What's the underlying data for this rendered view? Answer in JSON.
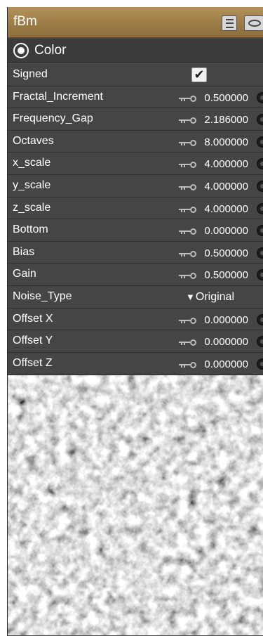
{
  "node": {
    "title": "fBm",
    "section_label": "Color"
  },
  "rows": [
    {
      "label": "Signed",
      "kind": "checkbox",
      "checked": true,
      "check_glyph": "✔"
    },
    {
      "label": "Fractal_Increment",
      "kind": "number",
      "value": "0.500000"
    },
    {
      "label": "Frequency_Gap",
      "kind": "number",
      "value": "2.186000"
    },
    {
      "label": "Octaves",
      "kind": "number",
      "value": "8.000000"
    },
    {
      "label": "x_scale",
      "kind": "number",
      "value": "4.000000"
    },
    {
      "label": "y_scale",
      "kind": "number",
      "value": "4.000000"
    },
    {
      "label": "z_scale",
      "kind": "number",
      "value": "4.000000"
    },
    {
      "label": "Bottom",
      "kind": "number",
      "value": "0.000000"
    },
    {
      "label": "Bias",
      "kind": "number",
      "value": "0.500000"
    },
    {
      "label": "Gain",
      "kind": "number",
      "value": "0.500000"
    },
    {
      "label": "Noise_Type",
      "kind": "dropdown",
      "value": "Original",
      "arrow": "▼"
    },
    {
      "label": "Offset X",
      "kind": "number",
      "value": "0.000000"
    },
    {
      "label": "Offset Y",
      "kind": "number",
      "value": "0.000000"
    },
    {
      "label": "Offset Z",
      "kind": "number",
      "value": "0.000000"
    }
  ],
  "icons": {
    "title_buttons": [
      "list-icon",
      "eye-icon"
    ],
    "section": "radio-target-icon",
    "row_key": "key-icon",
    "row_connector": "connector-port-icon"
  },
  "colors": {
    "titlebar": "#9a7a45",
    "panel": "#454545",
    "text": "#ffffff"
  }
}
